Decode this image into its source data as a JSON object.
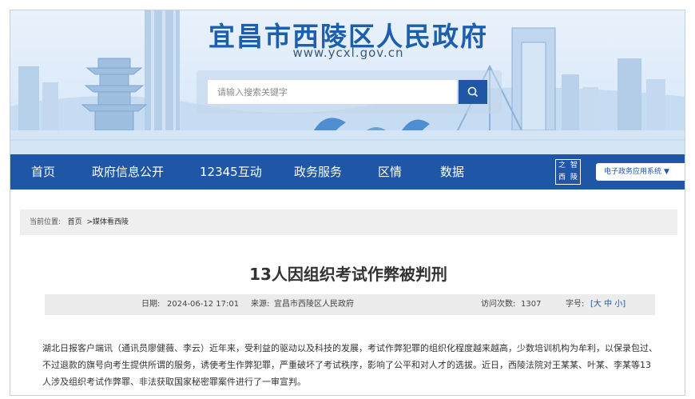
{
  "site": {
    "title": "宜昌市西陵区人民政府",
    "url": "www.ycxl.gov.cn",
    "search_placeholder": "请输入搜索关键字",
    "accent_color": "#1f57a6",
    "banner_color": "#dceafa"
  },
  "nav": {
    "items": [
      {
        "label": "首页"
      },
      {
        "label": "政府信息公开"
      },
      {
        "label": "12345互动"
      },
      {
        "label": "政务服务"
      },
      {
        "label": "区情"
      },
      {
        "label": "数据"
      }
    ],
    "logo_chars": [
      "之",
      "智",
      "西",
      "陵"
    ],
    "select_label": "电子政务应用系统",
    "select_arrow": "▼"
  },
  "breadcrumb": {
    "label": "当前位置:",
    "home": "首页",
    "section": ">媒体看西陵"
  },
  "article": {
    "title": "13人因组织考试作弊被判刑",
    "date_label": "日期:",
    "date": "2024-06-12 17:01",
    "source_label": "来源:",
    "source": "宜昌市西陵区人民政府",
    "visits_label": "访问次数:",
    "visits": "1307",
    "font_label": "字号:",
    "font_options": "[大 中 小]",
    "body": "湖北日报客户端讯（通讯员廖健薇、李云）近年来，受利益的驱动以及科技的发展，考试作弊犯罪的组织化程度越来越高，少数培训机构为牟利，以保录包过、不过退款的旗号向考生提供所谓的服务，诱使考生作弊犯罪，严重破坏了考试秩序，影响了公平和对人才的选拔。近日，西陵法院对王某某、叶某、李某等13人涉及组织考试作弊罪、非法获取国家秘密罪案件进行了一审宣判。"
  }
}
